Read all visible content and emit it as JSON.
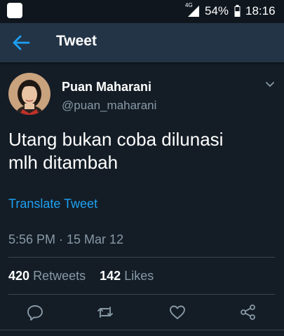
{
  "status_bar": {
    "network_type": "4G",
    "battery_percent": "54%",
    "time": "18:16"
  },
  "toolbar": {
    "title": "Tweet",
    "back_icon": "arrow-left-icon"
  },
  "tweet": {
    "author_name": "Puan Maharani",
    "author_handle": "@puan_maharani",
    "text_lines": [
      "Utang bukan coba dilunasi",
      "mlh ditambah"
    ],
    "translate_label": "Translate Tweet",
    "timestamp": "5:56 PM · 15 Mar 12",
    "retweets_count": "420",
    "retweets_label": "Retweets",
    "likes_count": "142",
    "likes_label": "Likes"
  },
  "actions": [
    {
      "icon": "reply-icon"
    },
    {
      "icon": "retweet-icon"
    },
    {
      "icon": "like-icon"
    },
    {
      "icon": "share-icon"
    }
  ],
  "colors": {
    "background": "#141d26",
    "toolbar": "#243447",
    "accent": "#1da1f2",
    "secondary_text": "#8899a6"
  }
}
